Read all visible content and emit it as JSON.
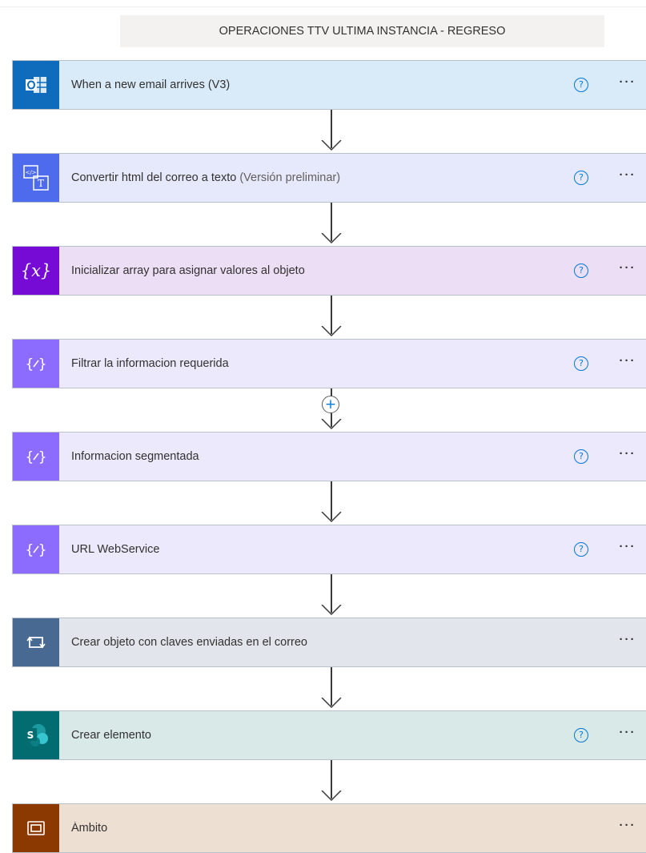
{
  "flow": {
    "title": "OPERACIONES TTV ULTIMA INSTANCIA - REGRESO"
  },
  "steps": [
    {
      "label": "When a new email arrives (V3)",
      "suffix": "",
      "icon": "outlook-icon",
      "has_help": true,
      "bg": "#d9ebf9",
      "icon_bg": "#0f6cbd"
    },
    {
      "label": "Convertir html del correo a texto",
      "suffix": "(Versión preliminar)",
      "icon": "html-to-text-icon",
      "has_help": true,
      "bg": "#e6e9fb",
      "icon_bg": "#4f6bed"
    },
    {
      "label": "Inicializar array para asignar valores al objeto",
      "suffix": "",
      "icon": "variable-icon",
      "has_help": true,
      "bg": "#ecdff5",
      "icon_bg": "#770bd6"
    },
    {
      "label": "Filtrar la informacion requerida",
      "suffix": "",
      "icon": "compose-icon",
      "has_help": true,
      "bg": "#ede9fc",
      "icon_bg": "#8c6cff"
    },
    {
      "label": "Informacion segmentada",
      "suffix": "",
      "icon": "compose-icon",
      "has_help": true,
      "bg": "#ede9fc",
      "icon_bg": "#8c6cff"
    },
    {
      "label": "URL WebService",
      "suffix": "",
      "icon": "compose-icon",
      "has_help": true,
      "bg": "#ede9fc",
      "icon_bg": "#8c6cff"
    },
    {
      "label": "Crear objeto con claves enviadas en el correo",
      "suffix": "",
      "icon": "apply-to-each-icon",
      "has_help": false,
      "bg": "#e2e6ec",
      "icon_bg": "#486991"
    },
    {
      "label": "Crear elemento",
      "suffix": "",
      "icon": "sharepoint-icon",
      "has_help": true,
      "bg": "#d8e9e7",
      "icon_bg": "#036c70"
    },
    {
      "label": "Ámbito",
      "suffix": "",
      "icon": "scope-icon",
      "has_help": false,
      "bg": "#eedfd3",
      "icon_bg": "#8c3900"
    }
  ],
  "controls": {
    "help_glyph": "?",
    "more_glyph": "···",
    "add_glyph": "+"
  }
}
